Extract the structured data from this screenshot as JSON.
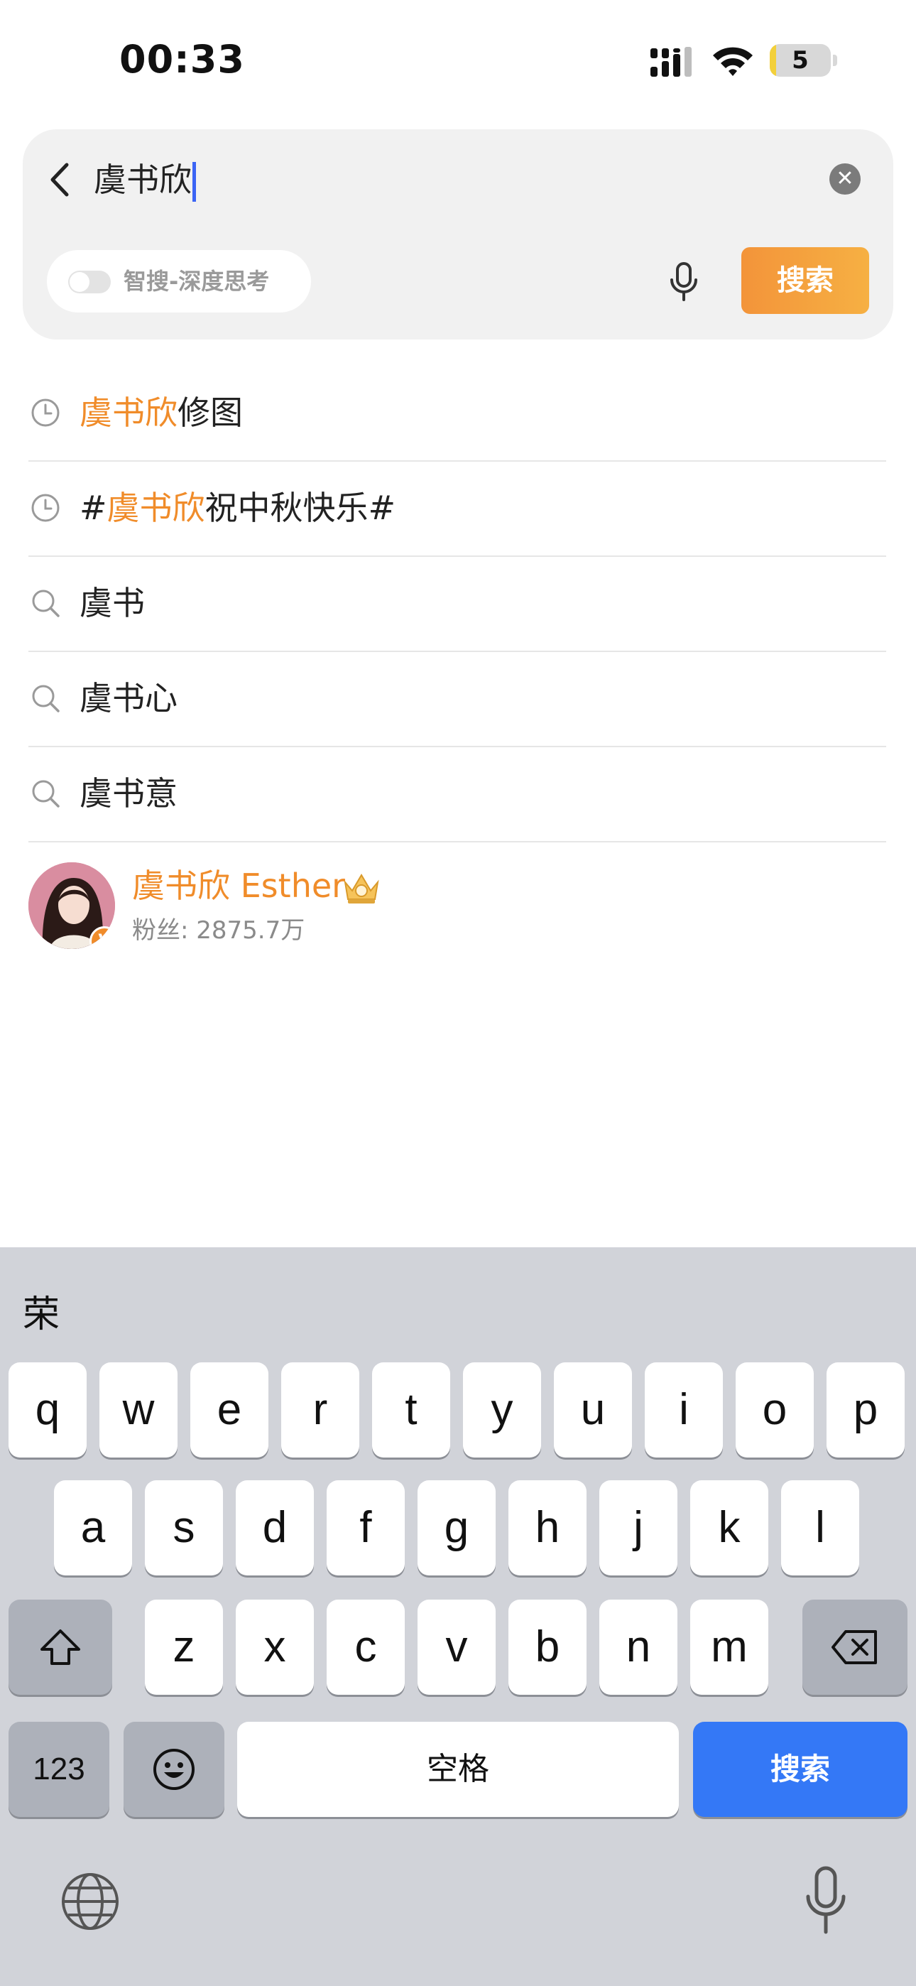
{
  "status_bar": {
    "time": "00:33",
    "battery": "5",
    "battery_level": 0.05
  },
  "search": {
    "query": "虞书欣",
    "mode_label": "智搜-深度思考",
    "search_button": "搜索"
  },
  "suggestions": [
    {
      "icon": "history-icon",
      "pre": "",
      "hl": "虞书欣",
      "post": "修图"
    },
    {
      "icon": "history-icon",
      "pre": "#",
      "hl": "虞书欣",
      "post": "祝中秋快乐#"
    },
    {
      "icon": "search-icon",
      "pre": "",
      "hl": "",
      "post": "虞书"
    },
    {
      "icon": "search-icon",
      "pre": "",
      "hl": "",
      "post": "虞书心"
    },
    {
      "icon": "search-icon",
      "pre": "",
      "hl": "",
      "post": "虞书意"
    }
  ],
  "user_suggestion": {
    "name": "虞书欣 Esther",
    "fans": "粉丝: 2875.7万",
    "verified_badge": "V"
  },
  "keyboard": {
    "candidate": "荣",
    "row1": [
      "q",
      "w",
      "e",
      "r",
      "t",
      "y",
      "u",
      "i",
      "o",
      "p"
    ],
    "row2": [
      "a",
      "s",
      "d",
      "f",
      "g",
      "h",
      "j",
      "k",
      "l"
    ],
    "row3": [
      "z",
      "x",
      "c",
      "v",
      "b",
      "n",
      "m"
    ],
    "numbers_key": "123",
    "space_key": "空格",
    "return_key": "搜索"
  },
  "colors": {
    "accent": "#f08c2a",
    "keyboard_blue": "#3478f6",
    "caret": "#3b64f5"
  }
}
